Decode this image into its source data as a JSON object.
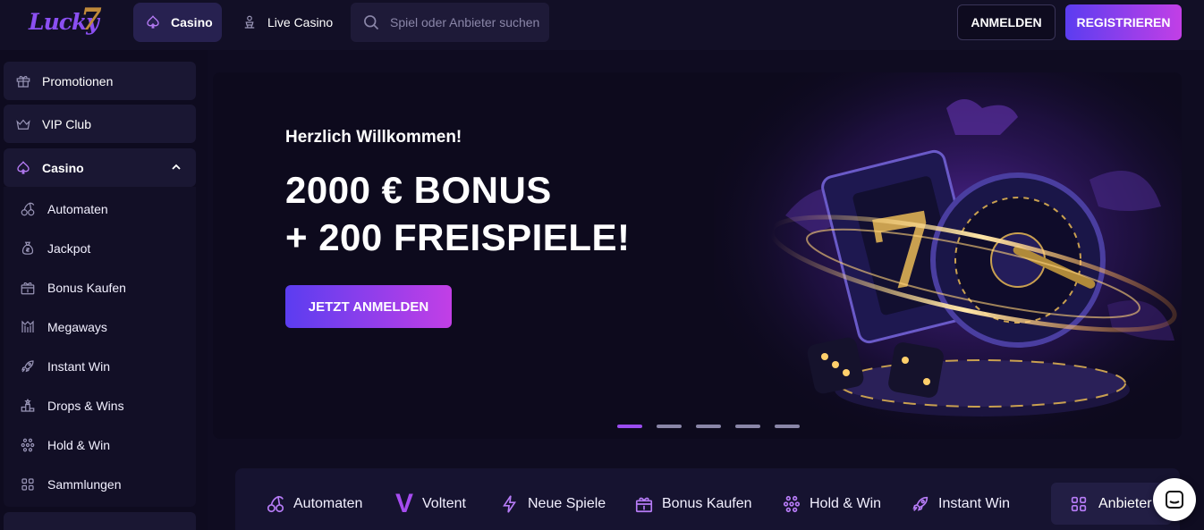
{
  "brand": {
    "logo_text": "Lucky",
    "logo_seven": "7"
  },
  "header": {
    "tabs": [
      {
        "label": "Casino",
        "active": true,
        "icon": "spade-icon"
      },
      {
        "label": "Live Casino",
        "active": false,
        "icon": "dealer-icon"
      }
    ],
    "search_placeholder": "Spiel oder Anbieter suchen",
    "login_label": "ANMELDEN",
    "register_label": "REGISTRIEREN"
  },
  "sidebar": {
    "items": [
      {
        "label": "Promotionen",
        "icon": "gift-icon"
      },
      {
        "label": "VIP Club",
        "icon": "crown-icon"
      },
      {
        "label": "Casino",
        "icon": "spade-icon",
        "expanded": true
      }
    ],
    "casino_sub": [
      {
        "label": "Automaten",
        "icon": "cherry-icon"
      },
      {
        "label": "Jackpot",
        "icon": "money-bag-icon"
      },
      {
        "label": "Bonus Kaufen",
        "icon": "gift-dollar-icon"
      },
      {
        "label": "Megaways",
        "icon": "megaways-icon"
      },
      {
        "label": "Instant Win",
        "icon": "rocket-icon"
      },
      {
        "label": "Drops & Wins",
        "icon": "podium-icon"
      },
      {
        "label": "Hold & Win",
        "icon": "dots-grid-icon"
      },
      {
        "label": "Sammlungen",
        "icon": "grid-icon"
      }
    ]
  },
  "hero": {
    "subtitle": "Herzlich Willkommen!",
    "title_line1": "2000 € BONUS",
    "title_line2": "+ 200 FREISPIELE!",
    "cta_label": "JETZT ANMELDEN",
    "slides_total": 5,
    "active_slide": 1
  },
  "categories": [
    {
      "label": "Automaten",
      "icon": "cherry-icon"
    },
    {
      "label": "Voltent",
      "icon": "voltent-v-logo",
      "glyph": "V"
    },
    {
      "label": "Neue Spiele",
      "icon": "lightning-icon"
    },
    {
      "label": "Bonus Kaufen",
      "icon": "gift-dollar-icon"
    },
    {
      "label": "Hold & Win",
      "icon": "dots-grid-icon"
    },
    {
      "label": "Instant Win",
      "icon": "rocket-icon"
    }
  ],
  "providers_label": "Anbieter",
  "colors": {
    "accent": "#9b4cf0",
    "gradient_start": "#5b3df0",
    "gradient_end": "#c23fe6",
    "background": "#0e0b1f"
  }
}
